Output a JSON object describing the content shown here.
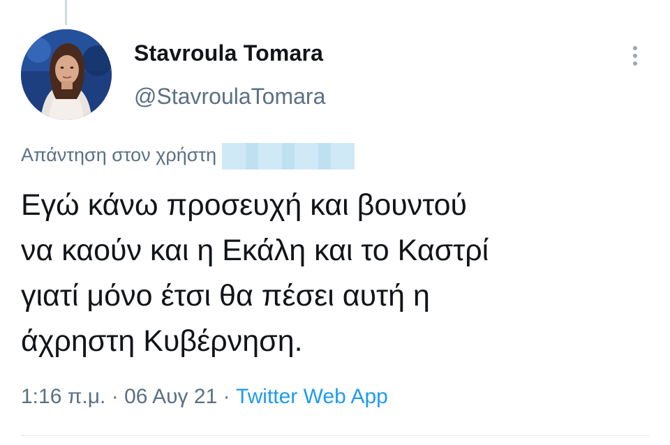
{
  "tweet": {
    "display_name": "Stavroula Tomara",
    "handle": "@StavroulaTomara",
    "reply_label": "Απάντηση στον χρήστη",
    "text": "Εγώ κάνω προσευχή και βουντού\nνα καούν και η Εκάλη και το Καστρί\nγιατί μόνο έτσι θα πέσει αυτή η\nάχρηστη Κυβέρνηση.",
    "time": "1:16 π.μ.",
    "separator": "·",
    "date": "06 Αυγ 21",
    "source": "Twitter Web App"
  },
  "icons": {
    "more": "more-vertical-icon",
    "avatar": "profile-photo"
  },
  "colors": {
    "primary_text": "#111418",
    "secondary_text": "#5b7083",
    "link": "#1d9bf0",
    "divider": "#e1e8ed"
  }
}
